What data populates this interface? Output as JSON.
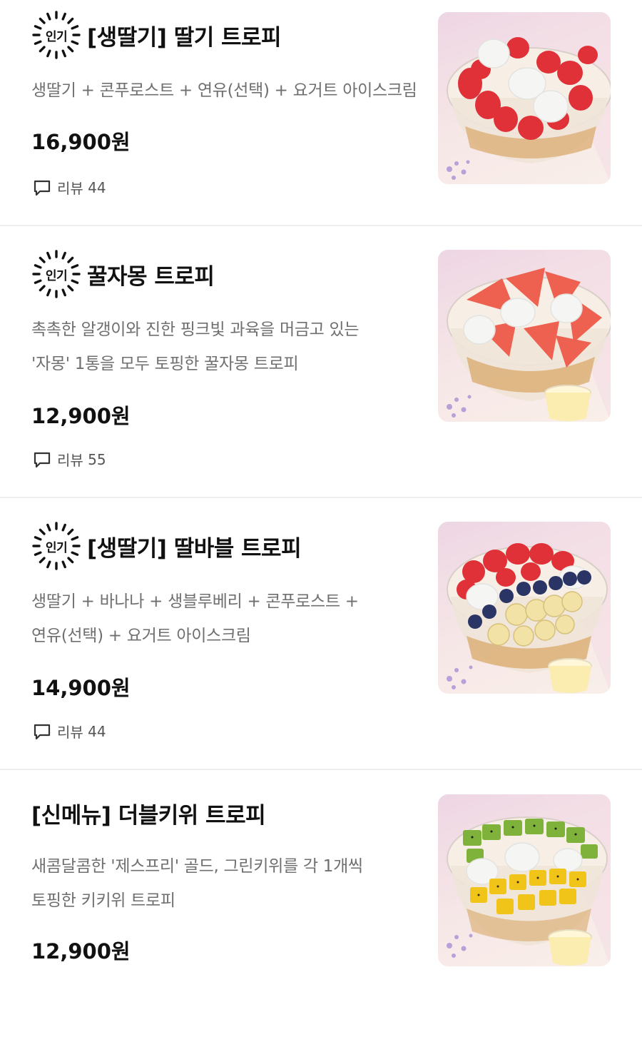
{
  "items": [
    {
      "badge": "인기",
      "title": "[생딸기] 딸기 트로피",
      "desc": [
        "생딸기 + 콘푸로스트 + 연유(선택) + 요거트 아이스크림"
      ],
      "price": "16,900원",
      "review_label": "리뷰",
      "review_count": "44",
      "image": "strawberry-trophy-bowl"
    },
    {
      "badge": "인기",
      "title": "꿀자몽 트로피",
      "desc": [
        "촉촉한 알갱이와 진한 핑크빛 과육을 머금고 있는",
        "'자몽' 1통을 모두 토핑한 꿀자몽 트로피"
      ],
      "price": "12,900원",
      "review_label": "리뷰",
      "review_count": "55",
      "image": "grapefruit-trophy-bowl"
    },
    {
      "badge": "인기",
      "title": "[생딸기] 딸바블 트로피",
      "desc": [
        "생딸기 + 바나나 + 생블루베리 + 콘푸로스트 +",
        "연유(선택) + 요거트 아이스크림"
      ],
      "price": "14,900원",
      "review_label": "리뷰",
      "review_count": "44",
      "image": "strawberry-banana-blueberry-bowl"
    },
    {
      "badge": "",
      "title": "[신메뉴] 더블키위 트로피",
      "desc": [
        "새콤달콤한 '제스프리' 골드, 그린키위를 각 1개씩",
        "토핑한 키키위 트로피"
      ],
      "price": "12,900원",
      "review_label": "",
      "review_count": "",
      "image": "double-kiwi-bowl"
    }
  ],
  "colors": {
    "title": "#111111",
    "desc": "#6f6f6f",
    "divider": "#eeeeee",
    "strawberry": "#e8303a",
    "grapefruit": "#ee6150",
    "banana": "#f3e2a6",
    "blueberry": "#2a3566",
    "kiwi_green": "#7fb23a",
    "kiwi_gold": "#f0c419"
  }
}
